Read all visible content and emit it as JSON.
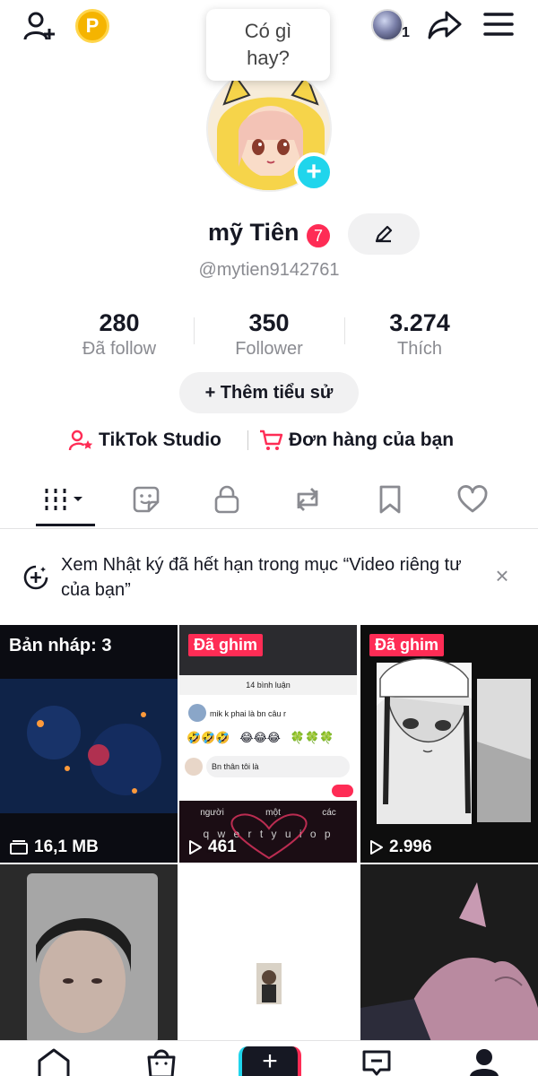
{
  "tooltip": {
    "text": "Có gì hay?"
  },
  "topbar": {
    "coin_letter": "P",
    "account_badge": "1"
  },
  "profile": {
    "name": "mỹ Tiên",
    "name_badge": "7",
    "username": "@mytien9142761"
  },
  "stats": [
    {
      "value": "280",
      "label": "Đã follow"
    },
    {
      "value": "350",
      "label": "Follower"
    },
    {
      "value": "3.274",
      "label": "Thích"
    }
  ],
  "bio_button": "+ Thêm tiểu sử",
  "links": {
    "studio": "TikTok Studio",
    "orders": "Đơn hàng của bạn"
  },
  "notice": {
    "text": "Xem Nhật ký đã hết hạn trong mục “Video riêng tư của bạn”"
  },
  "grid": {
    "draft_label": "Bản nháp: 3",
    "draft_size": "16,1 MB",
    "pinned_label": "Đã ghim",
    "video2_views": "461",
    "video3_views": "2.996",
    "chat_header": "14 bình luận",
    "chat_comment": "mik k phai là bn câu r",
    "chat_input": "Bn thân tôi là",
    "kb_word1": "người",
    "kb_word2": "một",
    "kb_word3": "các",
    "kb_row": "q w e r t y u i o p"
  },
  "colors": {
    "accent": "#fe2c55",
    "cyan": "#20d5ec",
    "text": "#161823",
    "muted": "#8a8b91"
  }
}
